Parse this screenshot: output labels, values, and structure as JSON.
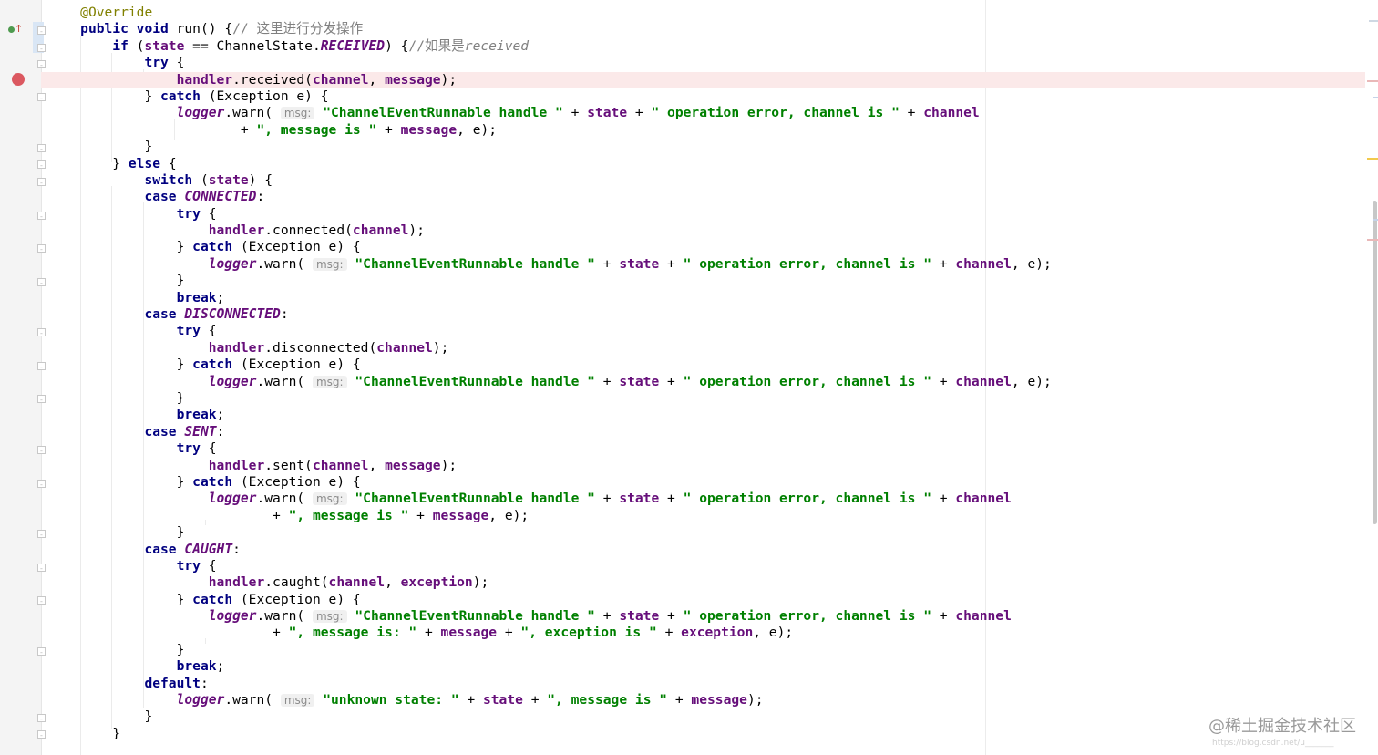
{
  "editor": {
    "language": "Java",
    "colors": {
      "keyword": "#000080",
      "annotation": "#808000",
      "comment": "#808080",
      "field": "#660e7a",
      "string": "#008000",
      "breakpoint": "#db5860",
      "breakpoint_line": "#fbe9e9"
    },
    "gutter": {
      "icons": [
        "override-method-icon",
        "breakpoint-icon",
        "fold-marker-icon"
      ]
    },
    "hint_label": "msg:",
    "tokens": {
      "t0": "@Override",
      "t1": "public",
      "t2": " ",
      "t3": "void",
      "t4": " run() {",
      "t5": "// 这里进行分发操作",
      "t6": "if",
      "t7": " (",
      "t8": "state",
      "t9": " == ChannelState.",
      "t10": "RECEIVED",
      "t11": ") {",
      "t12": "//如果是",
      "t13": "received",
      "t14": "try",
      "t15": " {",
      "t16": "handler",
      "t17": ".received(",
      "t18": "channel",
      "t19": ", ",
      "t20": "message",
      "t21": ");",
      "t22": "} ",
      "t23": "catch",
      "t24": " (Exception e) {",
      "t25": "logger",
      "t26": ".warn(",
      "t27": "\"ChannelEventRunnable handle \"",
      "t28": " + ",
      "t29": "\" operation error, channel is \"",
      "t30": "+ ",
      "t31": "\", message is \"",
      "t32": ", e);",
      "t33": "}",
      "t34": "else",
      "t35": "switch",
      "t36": "case",
      "t37": "CONNECTED",
      "t38": ":",
      "t39": ".connected(",
      "t40": "break",
      "t41": ";",
      "t42": "DISCONNECTED",
      "t43": ".disconnected(",
      "t44": "SENT",
      "t45": ".sent(",
      "t46": "CAUGHT",
      "t47": ".caught(",
      "t48": "exception",
      "t49": "\", message is: \"",
      "t50": "\", exception is \"",
      "t51": "default",
      "t52": "\"unknown state: \"",
      "t53": "\", message is \"",
      "t54": ") {"
    }
  },
  "watermark": {
    "text": "@稀土掘金技术社区",
    "url": "https://blog.csdn.net/u_______"
  }
}
